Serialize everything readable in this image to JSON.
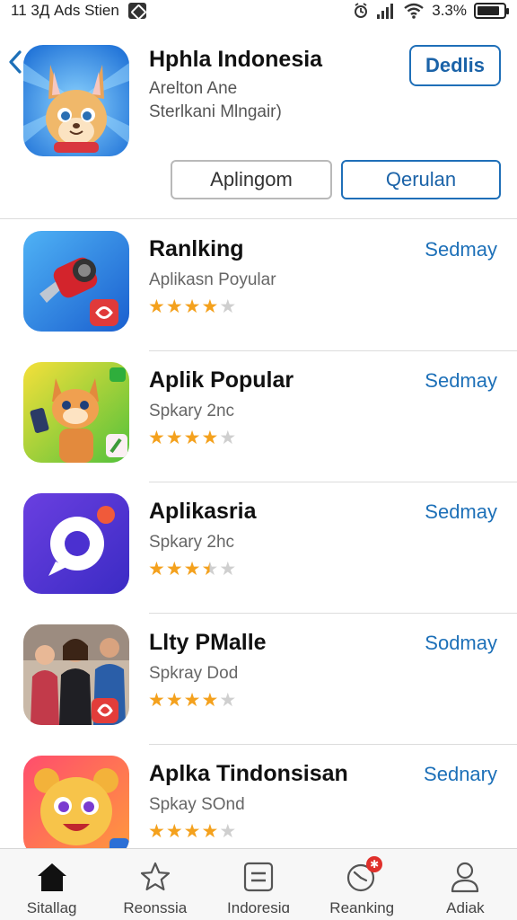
{
  "status_bar": {
    "time": "11 3Д Ads Stien",
    "battery": "3.3%",
    "battery_level": 0.85,
    "icons": [
      "notification-icon",
      "alarm-icon",
      "signal-icon",
      "wifi-icon",
      "battery-icon"
    ]
  },
  "header": {
    "title": "Hphla Indonesia",
    "subtitle_line1": "Arelton Ane",
    "subtitle_line2": "Sterlkani Mlngair)",
    "details_button": "Dedlis",
    "button_left": "Aplingom",
    "button_right": "Qerulan",
    "icon": "cartoon-fox-icon"
  },
  "apps": [
    {
      "title": "Ranlking",
      "subtitle": "Aplikasn Poyular",
      "action": "Sedmay",
      "rating": 4,
      "icon": "drill-tool-icon"
    },
    {
      "title": "Aplik Popular",
      "subtitle": "Spkary 2nc",
      "action": "Sedmay",
      "rating": 4,
      "icon": "cartoon-cat-phone-icon"
    },
    {
      "title": "Aplikasria",
      "subtitle": "Spkary 2hc",
      "action": "Sedmay",
      "rating": 3.5,
      "icon": "chat-bubble-icon"
    },
    {
      "title": "Llty PMalle",
      "subtitle": "Spkray Dod",
      "action": "Sodmay",
      "rating": 4,
      "icon": "people-photo-icon"
    },
    {
      "title": "Aplka Tindonsisan",
      "subtitle": "Spkay SOnd",
      "action": "Sednary",
      "rating": 4,
      "icon": "cartoon-bear-icon"
    }
  ],
  "bottom_nav": [
    {
      "label": "Sitallag",
      "icon": "home-icon",
      "active": true
    },
    {
      "label": "Reonssia",
      "icon": "star-icon",
      "active": false
    },
    {
      "label": "Indoresiɑ",
      "icon": "list-icon",
      "active": false
    },
    {
      "label": "Reanking",
      "icon": "clock-badge-icon",
      "active": false
    },
    {
      "label": "Adiak",
      "icon": "person-icon",
      "active": false
    }
  ],
  "colors": {
    "accent": "#1d70b8",
    "star": "#f4a11d",
    "star_empty": "#cfcfcf",
    "divider": "#dcdcdc"
  }
}
